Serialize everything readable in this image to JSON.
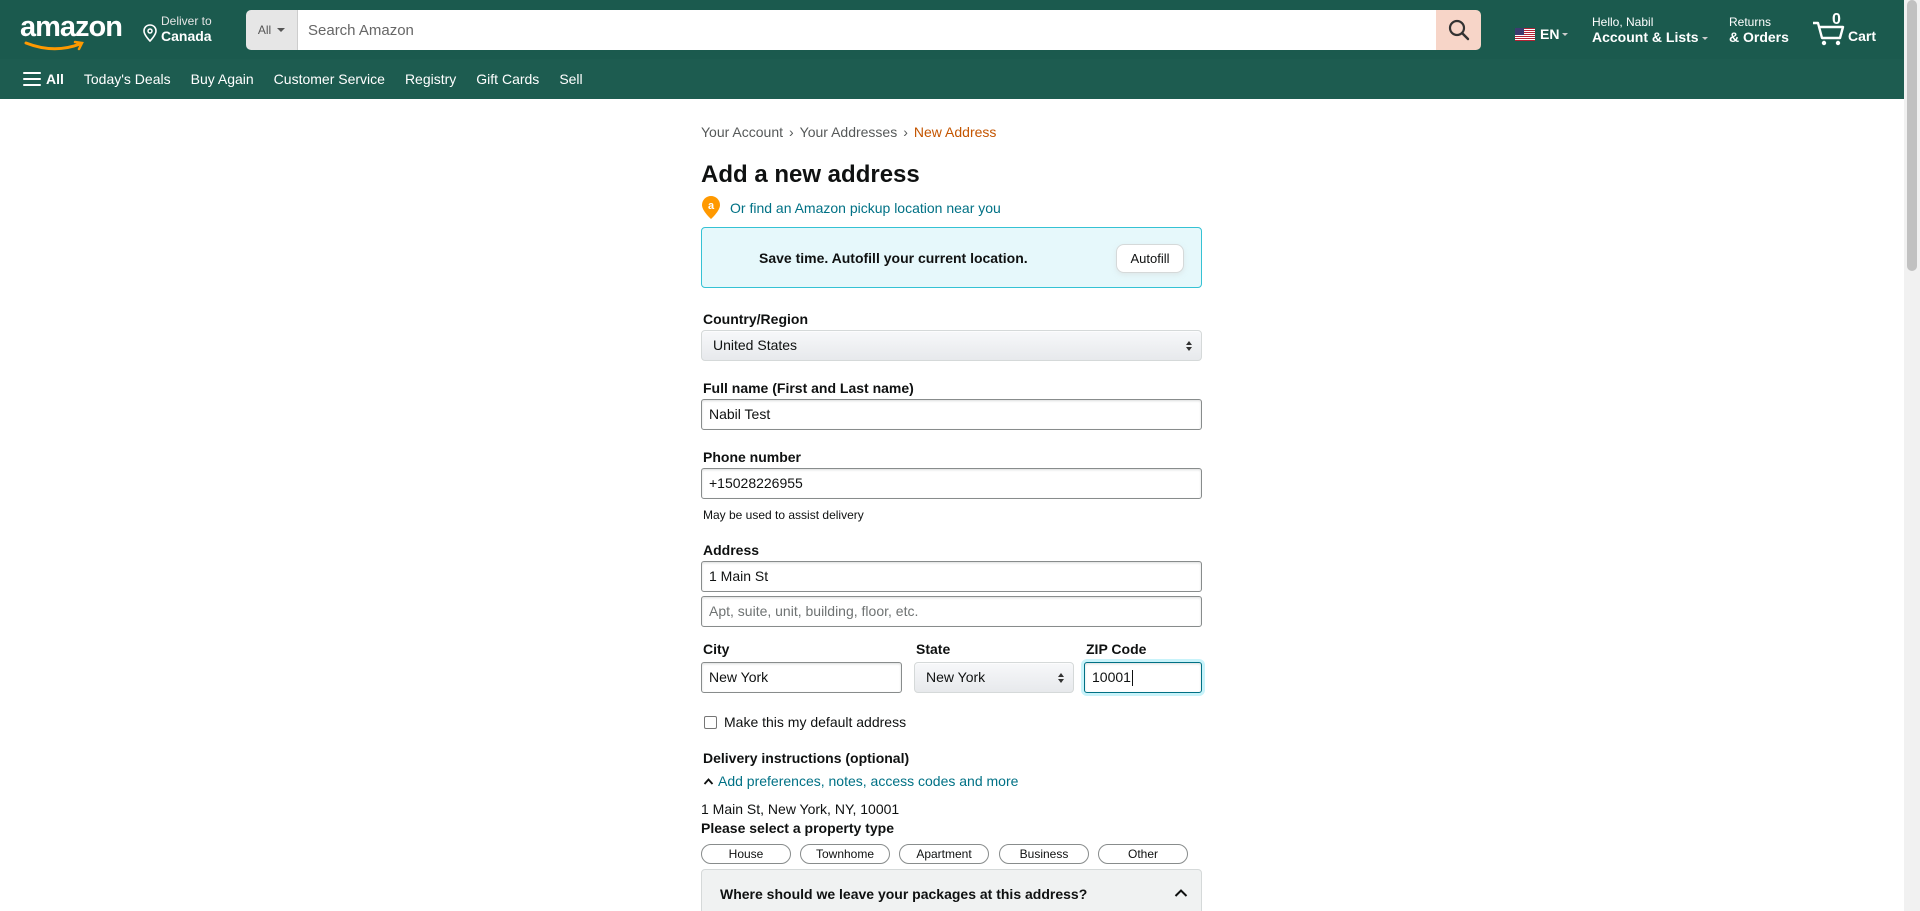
{
  "header": {
    "logo": "amazon",
    "deliver_line1": "Deliver to",
    "deliver_line2": "Canada",
    "search_category": "All",
    "search_placeholder": "Search Amazon",
    "language": "EN",
    "account_line1": "Hello, Nabil",
    "account_line2": "Account & Lists",
    "returns_line1": "Returns",
    "returns_line2": "& Orders",
    "cart_count": "0",
    "cart_label": "Cart"
  },
  "subnav": {
    "all_label": "All",
    "items": [
      "Today's Deals",
      "Buy Again",
      "Customer Service",
      "Registry",
      "Gift Cards",
      "Sell"
    ]
  },
  "breadcrumb": {
    "items": [
      "Your Account",
      "Your Addresses",
      "New Address"
    ],
    "separator": "›"
  },
  "page": {
    "title": "Add a new address",
    "pickup_link": "Or find an Amazon pickup location near you",
    "autofill_text": "Save time. Autofill your current location.",
    "autofill_button": "Autofill"
  },
  "form": {
    "country_label": "Country/Region",
    "country_value": "United States",
    "fullname_label": "Full name (First and Last name)",
    "fullname_value": "Nabil Test",
    "phone_label": "Phone number",
    "phone_value": "+15028226955",
    "phone_hint": "May be used to assist delivery",
    "address_label": "Address",
    "address_line1": "1 Main St",
    "address_line2_placeholder": "Apt, suite, unit, building, floor, etc.",
    "city_label": "City",
    "city_value": "New York",
    "state_label": "State",
    "state_value": "New York",
    "zip_label": "ZIP Code",
    "zip_value": "10001",
    "default_checkbox": "Make this my default address",
    "delivery_label": "Delivery instructions (optional)",
    "delivery_link": "Add preferences, notes, access codes and more",
    "address_summary": "1 Main St, New York, NY, 10001",
    "property_title": "Please select a property type",
    "property_types": [
      "House",
      "Townhome",
      "Apartment",
      "Business",
      "Other"
    ],
    "leave_question": "Where should we leave your packages at this address?"
  },
  "colors": {
    "nav_bg": "#1b5a4e",
    "link": "#007185",
    "breadcrumb_current": "#c45500",
    "info_box_bg": "#e6f8fb"
  }
}
